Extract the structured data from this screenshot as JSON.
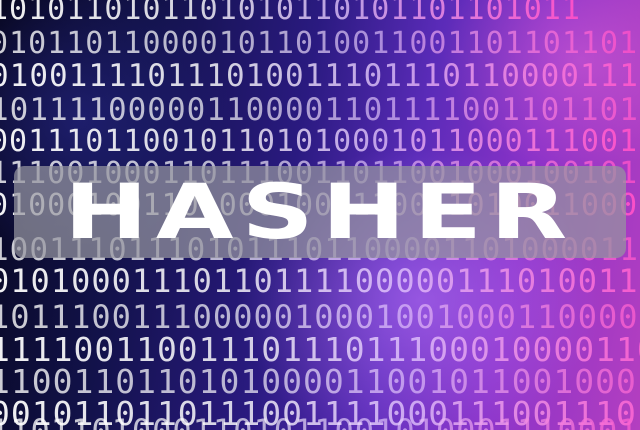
{
  "banner": {
    "title": "HASHER"
  },
  "background": {
    "rows": [
      "1010110101101010110101101101011",
      "0101101100001011010011001101101101",
      "0100111101110100111011101100001110",
      "1011110000011000011011110011011010",
      "0011101100101101010001011000111001",
      "1110010001101110011011001000100101",
      "0100010011010001000110011010011000",
      "1001110111010111011000011010000110",
      "0101000111011011110000011101001100",
      "1011100111000001000100100011000010",
      "1111001100111011101110001000011000",
      "1100110110101000011001011001000101",
      "0010110110111001111000111001110111",
      "1101101000110101100101000111000101"
    ],
    "colors": {
      "deep": "#07071f",
      "mid": "#2a1a80",
      "violet": "#8a32c8",
      "magenta": "#ff4fc8",
      "digit": "#ffffff"
    }
  }
}
